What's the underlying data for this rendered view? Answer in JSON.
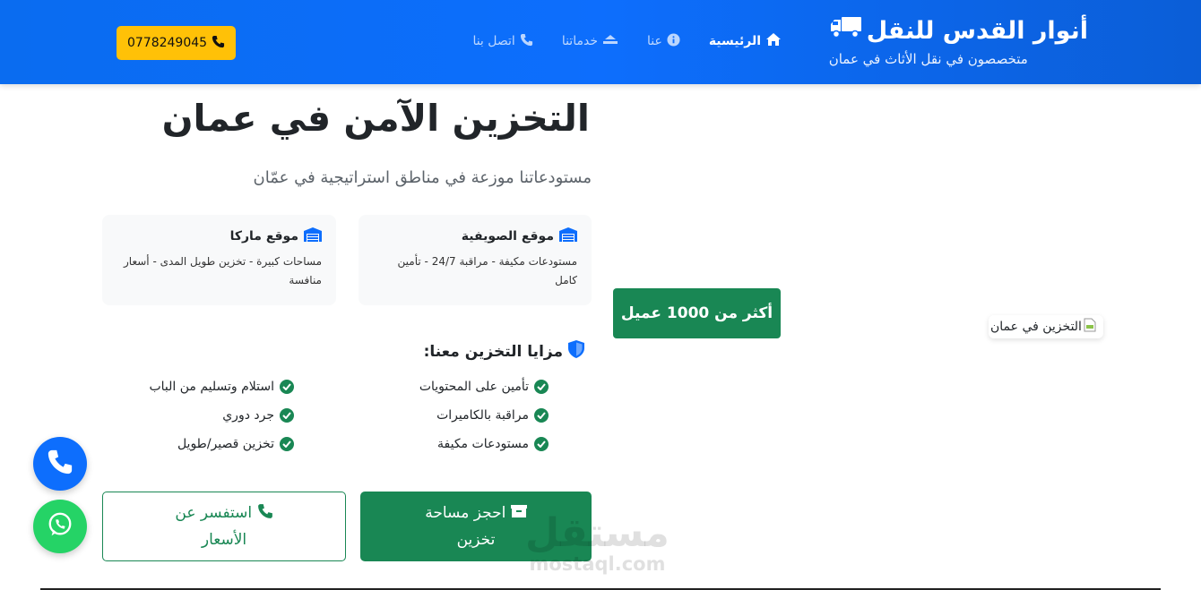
{
  "navbar": {
    "brand_title": "أنوار القدس للنقل",
    "brand_subtitle": "متخصصون في نقل الأثاث في عمان",
    "links": [
      {
        "label": "الرئيسية",
        "icon": "home-icon",
        "active": true
      },
      {
        "label": "عنا",
        "icon": "info-icon",
        "active": false
      },
      {
        "label": "خدماتنا",
        "icon": "truck-loading-icon",
        "active": false
      },
      {
        "label": "اتصل بنا",
        "icon": "phone-icon",
        "active": false
      }
    ],
    "phone_button": "0778249045"
  },
  "hero": {
    "title": "التخزين الآمن في عمان",
    "subtitle": "مستودعاتنا موزعة في مناطق استراتيجية في عمّان"
  },
  "locations": [
    {
      "title": "موقع الصويفية",
      "description": "مستودعات مكيفة - مراقبة 24/7 - تأمين كامل",
      "icon": "warehouse-icon"
    },
    {
      "title": "موقع ماركا",
      "description": "مساحات كبيرة - تخزين طويل المدى - أسعار منافسة",
      "icon": "warehouse-icon"
    }
  ],
  "features": {
    "heading": "مزايا التخزين معنا:",
    "heading_icon": "shield-icon",
    "items": [
      "تأمين على المحتويات",
      "مراقبة بالكاميرات",
      "مستودعات مكيفة",
      "استلام وتسليم من الباب",
      "جرد دوري",
      "تخزين قصير/طويل"
    ]
  },
  "buttons": {
    "book": "احجز مساحة تخزين",
    "inquire": "استفسر عن الأسعار"
  },
  "badge": "أكثر من 1000 عميل",
  "image_alt": "التخزين في عمان",
  "floating": {
    "call_icon": "phone-icon",
    "whatsapp_icon": "whatsapp-icon"
  },
  "watermark": {
    "arabic": "مستقل",
    "latin": "mostaql.com"
  },
  "colors": {
    "primary": "#0d6efd",
    "success": "#198754",
    "warning": "#ffc107",
    "whatsapp": "#25d366"
  }
}
